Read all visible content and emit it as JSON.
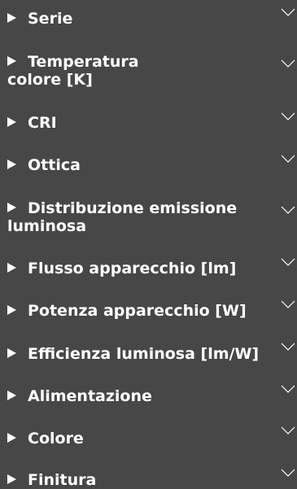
{
  "filters": [
    {
      "label": "Serie"
    },
    {
      "label": "Temperatura",
      "label2": "colore [K]"
    },
    {
      "label": "CRI"
    },
    {
      "label": "Ottica"
    },
    {
      "label": "Distribuzione emissione",
      "label2": "luminosa"
    },
    {
      "label": "Flusso apparecchio [lm]"
    },
    {
      "label": "Potenza apparecchio [W]"
    },
    {
      "label": "Efficienza luminosa [lm/W]"
    },
    {
      "label": "Alimentazione"
    },
    {
      "label": "Colore"
    },
    {
      "label": "Finitura"
    }
  ],
  "icons": {
    "expand": "triangle-right-icon",
    "dropdown": "chevron-down-icon"
  },
  "colors": {
    "background": "#474747",
    "text": "#ffffff"
  }
}
